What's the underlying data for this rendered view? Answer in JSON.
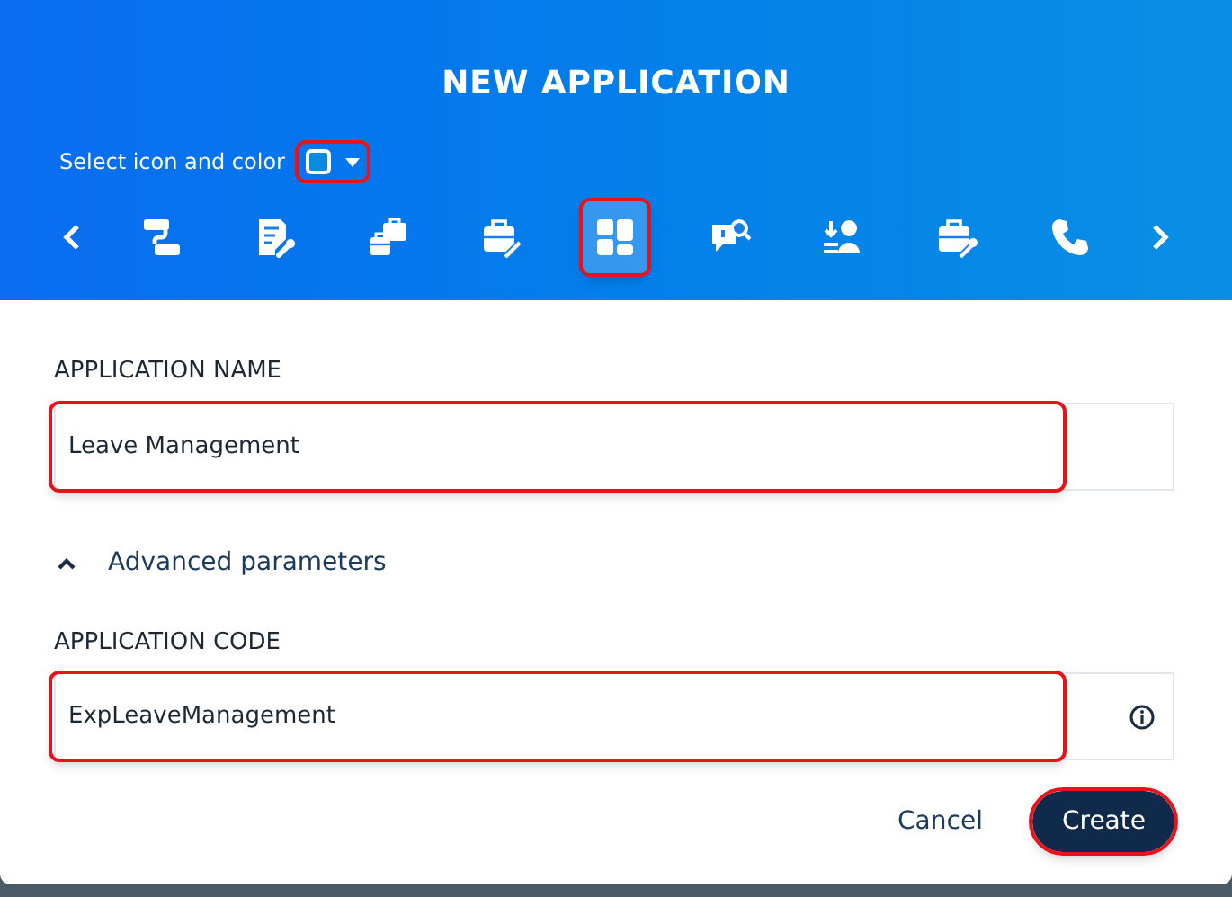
{
  "dialog": {
    "title": "NEW APPLICATION"
  },
  "icon_picker": {
    "label": "Select icon and color",
    "color": "#0a8be0",
    "highlighted": true,
    "icons": [
      {
        "kind": "flow",
        "selected": false
      },
      {
        "kind": "document-wrench",
        "selected": false
      },
      {
        "kind": "briefcases",
        "selected": false
      },
      {
        "kind": "briefcase-pen",
        "selected": false
      },
      {
        "kind": "dashboard",
        "selected": true
      },
      {
        "kind": "chat-search",
        "selected": false
      },
      {
        "kind": "download-person",
        "selected": false
      },
      {
        "kind": "briefcase-wrench",
        "selected": false
      },
      {
        "kind": "phone",
        "selected": false
      }
    ]
  },
  "fields": [
    {
      "label": "APPLICATION NAME",
      "value": "Leave Management",
      "highlighted": true,
      "info": false
    },
    {
      "label": "APPLICATION CODE",
      "value": "ExpLeaveManagement",
      "highlighted": true,
      "info": true
    }
  ],
  "advanced": {
    "label": "Advanced parameters",
    "expanded": true
  },
  "buttons": [
    {
      "label": "Cancel",
      "kind": "text",
      "highlighted": false
    },
    {
      "label": "Create",
      "kind": "primary",
      "highlighted": true
    }
  ]
}
